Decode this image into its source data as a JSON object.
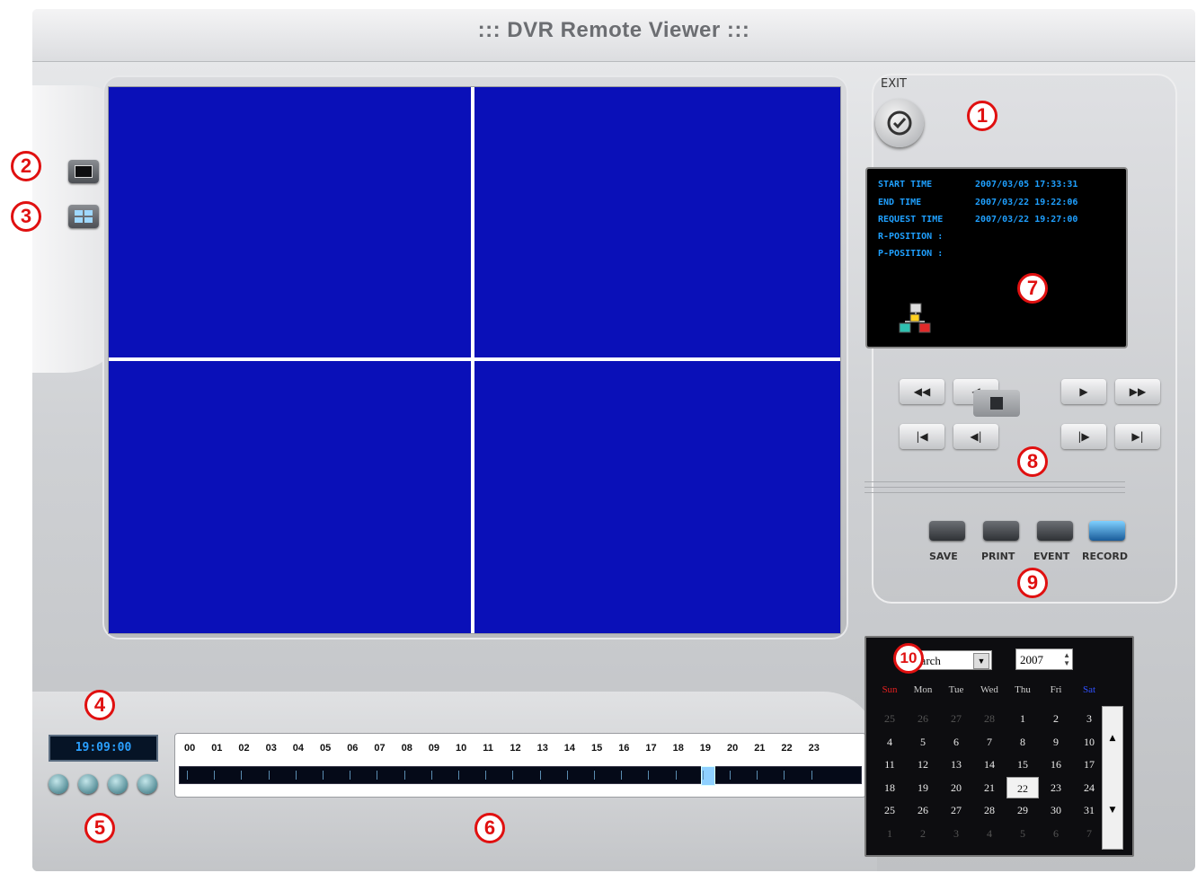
{
  "title": "::: DVR Remote Viewer :::",
  "exit": {
    "label": "EXIT"
  },
  "info": {
    "start_label": "START TIME",
    "start_value": "2007/03/05 17:33:31",
    "end_label": "END TIME",
    "end_value": "2007/03/22 19:22:06",
    "request_label": "REQUEST TIME",
    "request_value": "2007/03/22 19:27:00",
    "r_position": "R-POSITION :",
    "p_position": "P-POSITION :"
  },
  "actions": {
    "save": "SAVE",
    "print": "PRINT",
    "event": "EVENT",
    "record": "RECORD"
  },
  "time_display": "19:09:00",
  "timeline": {
    "hours": [
      "00",
      "01",
      "02",
      "03",
      "04",
      "05",
      "06",
      "07",
      "08",
      "09",
      "10",
      "11",
      "12",
      "13",
      "14",
      "15",
      "16",
      "17",
      "18",
      "19",
      "20",
      "21",
      "22",
      "23"
    ],
    "cursor_hour": 19
  },
  "calendar": {
    "month": "March",
    "year": "2007",
    "day_headers": [
      "Sun",
      "Mon",
      "Tue",
      "Wed",
      "Thu",
      "Fri",
      "Sat"
    ],
    "weeks": [
      [
        "25",
        "26",
        "27",
        "28",
        "1",
        "2",
        "3"
      ],
      [
        "4",
        "5",
        "6",
        "7",
        "8",
        "9",
        "10"
      ],
      [
        "11",
        "12",
        "13",
        "14",
        "15",
        "16",
        "17"
      ],
      [
        "18",
        "19",
        "20",
        "21",
        "22",
        "23",
        "24"
      ],
      [
        "25",
        "26",
        "27",
        "28",
        "29",
        "30",
        "31"
      ],
      [
        "1",
        "2",
        "3",
        "4",
        "5",
        "6",
        "7"
      ]
    ],
    "selected_day": "22",
    "sun_color": "#e02020",
    "sat_color": "#3050ff"
  },
  "markers": [
    "1",
    "2",
    "3",
    "4",
    "5",
    "6",
    "7",
    "8",
    "9",
    "10"
  ],
  "colors": {
    "video_bg": "#0a10b8",
    "info_text": "#1fa0ff",
    "marker": "#e01010"
  }
}
